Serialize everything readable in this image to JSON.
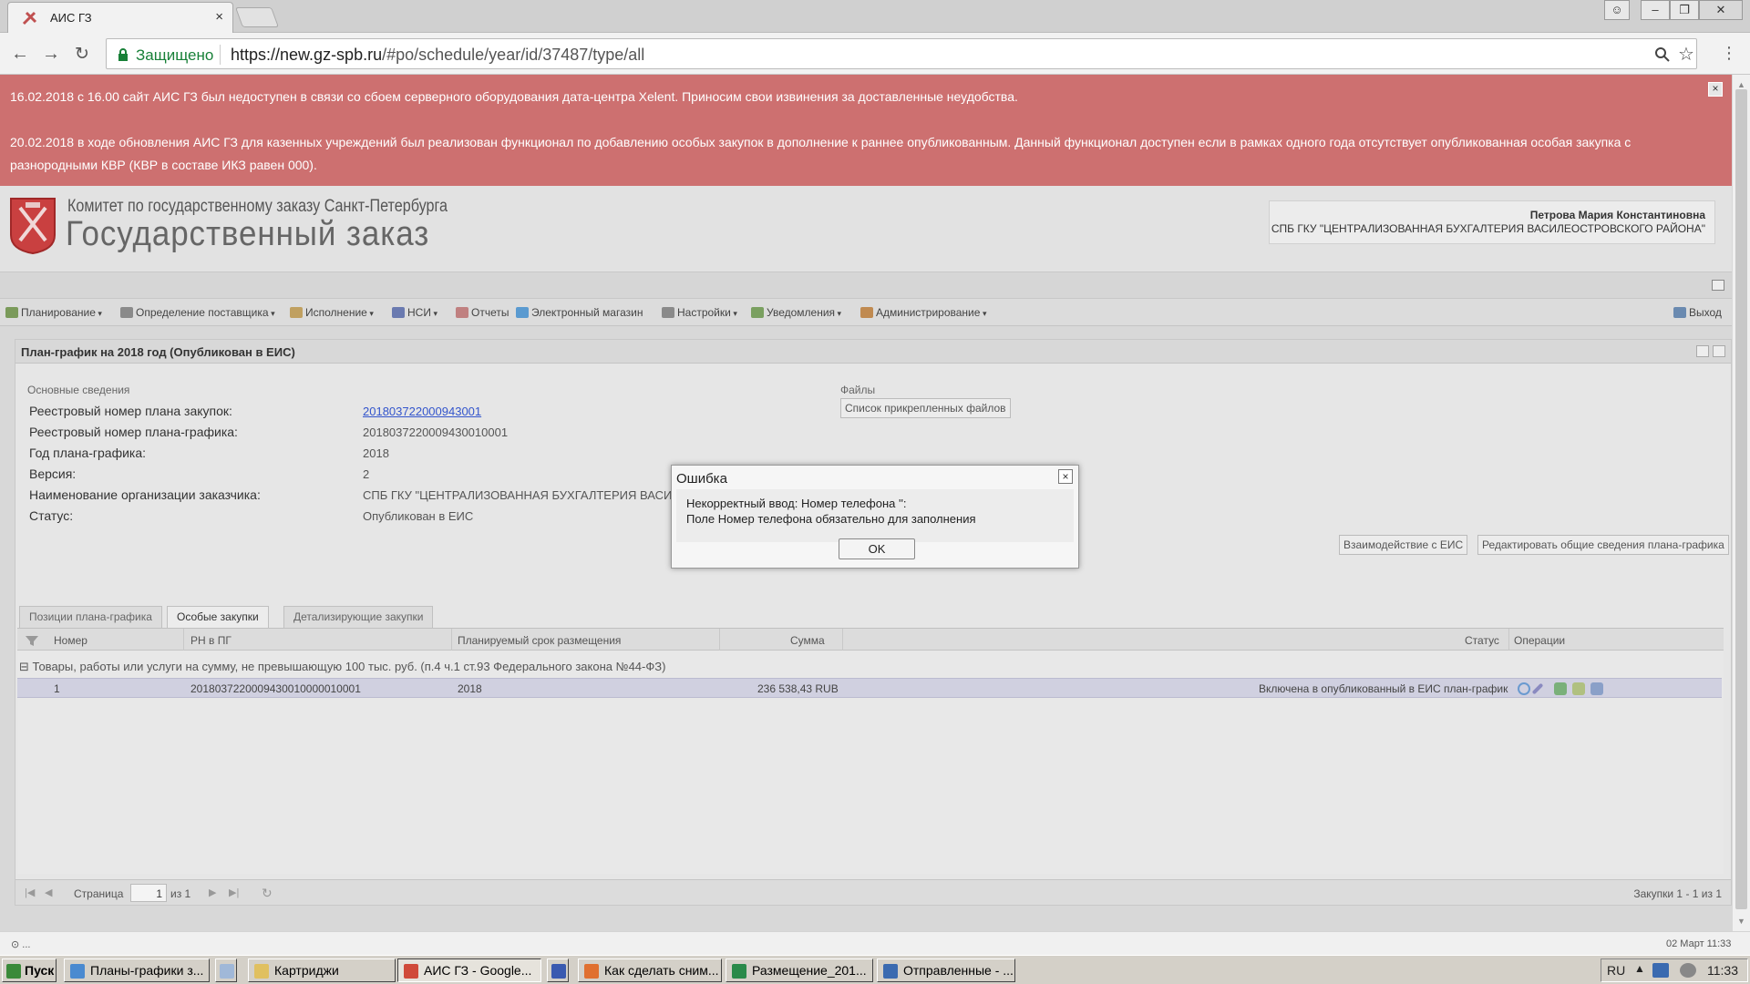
{
  "browser": {
    "tab_title": "АИС ГЗ",
    "tab_close": "×",
    "secure_label": "Защищено",
    "url_host": "https://new.gz-spb.ru",
    "url_path": "/#po/schedule/year/id/37487/type/all"
  },
  "banner": {
    "line1": "16.02.2018 с 16.00 сайт АИС ГЗ был недоступен в связи со сбоем серверного оборудования дата-центра Xelent. Приносим свои извинения за доставленные неудобства.",
    "line2": "20.02.2018 в ходе обновления АИС ГЗ для казенных учреждений был реализован функционал по добавлению особых закупок в дополнение к раннее опубликованным. Данный функционал доступен если в рамках одного года отсутствует опубликованная особая закупка с разнородными КВР (КВР в составе ИКЗ равен 000).",
    "close": "×"
  },
  "header": {
    "org_line": "Комитет по государственному заказу Санкт-Петербурга",
    "app_name": "Государственный заказ",
    "user_name": "Петрова Мария Константиновна",
    "user_org": "СПБ ГКУ \"ЦЕНТРАЛИЗОВАННАЯ БУХГАЛТЕРИЯ ВАСИЛЕОСТРОВСКОГО РАЙОНА\""
  },
  "menu": [
    {
      "label": "Планирование",
      "icon": "planning-icon",
      "color": "#7a9a5a",
      "dropdown": true
    },
    {
      "label": "Определение поставщика",
      "icon": "supplier-icon",
      "color": "#8a8a8a",
      "dropdown": true
    },
    {
      "label": "Исполнение",
      "icon": "execution-icon",
      "color": "#c0a060",
      "dropdown": true
    },
    {
      "label": "НСИ",
      "icon": "reference-book-icon",
      "color": "#6a7ab0",
      "dropdown": true
    },
    {
      "label": "Отчеты",
      "icon": "report-icon",
      "color": "#c08080",
      "dropdown": false
    },
    {
      "label": "Электронный магазин",
      "icon": "cart-icon",
      "color": "#5a9ad0",
      "dropdown": false
    },
    {
      "label": "Настройки",
      "icon": "wrench-icon",
      "color": "#8a8a8a",
      "dropdown": true
    },
    {
      "label": "Уведомления",
      "icon": "notification-icon",
      "color": "#7aa060",
      "dropdown": true
    },
    {
      "label": "Администрирование",
      "icon": "user-icon",
      "color": "#c08a50",
      "dropdown": true
    }
  ],
  "logout_label": "Выход",
  "panel": {
    "title": "План-график на 2018 год (Опубликован в ЕИС)",
    "main_section": "Основные сведения",
    "files_section": "Файлы",
    "files_button": "Список прикрепленных файлов",
    "fields": [
      {
        "label": "Реестровый номер плана закупок:",
        "value": "201803722000943001",
        "link": true
      },
      {
        "label": "Реестровый номер плана-графика:",
        "value": "2018037220009430010001",
        "link": false
      },
      {
        "label": "Год плана-графика:",
        "value": "2018",
        "link": false
      },
      {
        "label": "Версия:",
        "value": "2",
        "link": false
      },
      {
        "label": "Наименование организации заказчика:",
        "value": "СПБ ГКУ \"ЦЕНТРАЛИЗОВАННАЯ БУХГАЛТЕРИЯ ВАСИЛ",
        "link": false
      },
      {
        "label": "Статус:",
        "value": "Опубликован в ЕИС",
        "link": false
      }
    ],
    "btn_eis": "Взаимодействие с ЕИС",
    "btn_edit": "Редактировать общие сведения плана-графика"
  },
  "tabs": [
    "Позиции плана-графика",
    "Особые закупки",
    "Детализирующие закупки"
  ],
  "grid": {
    "columns": [
      "Номер",
      "РН в ПГ",
      "Планируемый срок размещения",
      "Сумма",
      "Статус",
      "Операции"
    ],
    "group_label": "Товары, работы или услуги на сумму, не превышающую 100 тыс. руб. (п.4 ч.1 ст.93 Федерального закона №44-ФЗ)",
    "group_toggle": "⊟",
    "rows": [
      {
        "num": "1",
        "rn": "2018037220009430010000010001",
        "term": "2018",
        "sum": "236 538,43 RUB",
        "status": "Включена в опубликованный в ЕИС план-график"
      }
    ]
  },
  "pager": {
    "page_label": "Страница",
    "page_value": "1",
    "of_label": "из 1",
    "summary": "Закупки 1 - 1 из 1"
  },
  "statusbar": {
    "left": "⊙ ...",
    "right": "02 Март 11:33"
  },
  "dialog": {
    "title": "Ошибка",
    "line1": "Некорректный ввод: Номер телефона '':",
    "line2": "Поле Номер телефона обязательно для заполнения",
    "ok": "OK",
    "close": "×"
  },
  "taskbar": {
    "start": "Пуск",
    "items": [
      {
        "label": "Планы-графики з...",
        "active": false,
        "color": "#4a8ad0"
      },
      {
        "label": "",
        "active": false,
        "color": "#a0b8d8"
      },
      {
        "label": "Картриджи",
        "active": false,
        "color": "#e0c060"
      },
      {
        "label": "АИС ГЗ - Google...",
        "active": true,
        "color": "#d04a3a"
      },
      {
        "label": "",
        "active": false,
        "color": "#3a5ab0"
      },
      {
        "label": "Как сделать сним...",
        "active": false,
        "color": "#e07030"
      },
      {
        "label": "Размещение_201...",
        "active": false,
        "color": "#2a8a4a"
      },
      {
        "label": "Отправленные - ...",
        "active": false,
        "color": "#3a6ab0"
      }
    ],
    "lang": "RU",
    "time": "11:33"
  }
}
